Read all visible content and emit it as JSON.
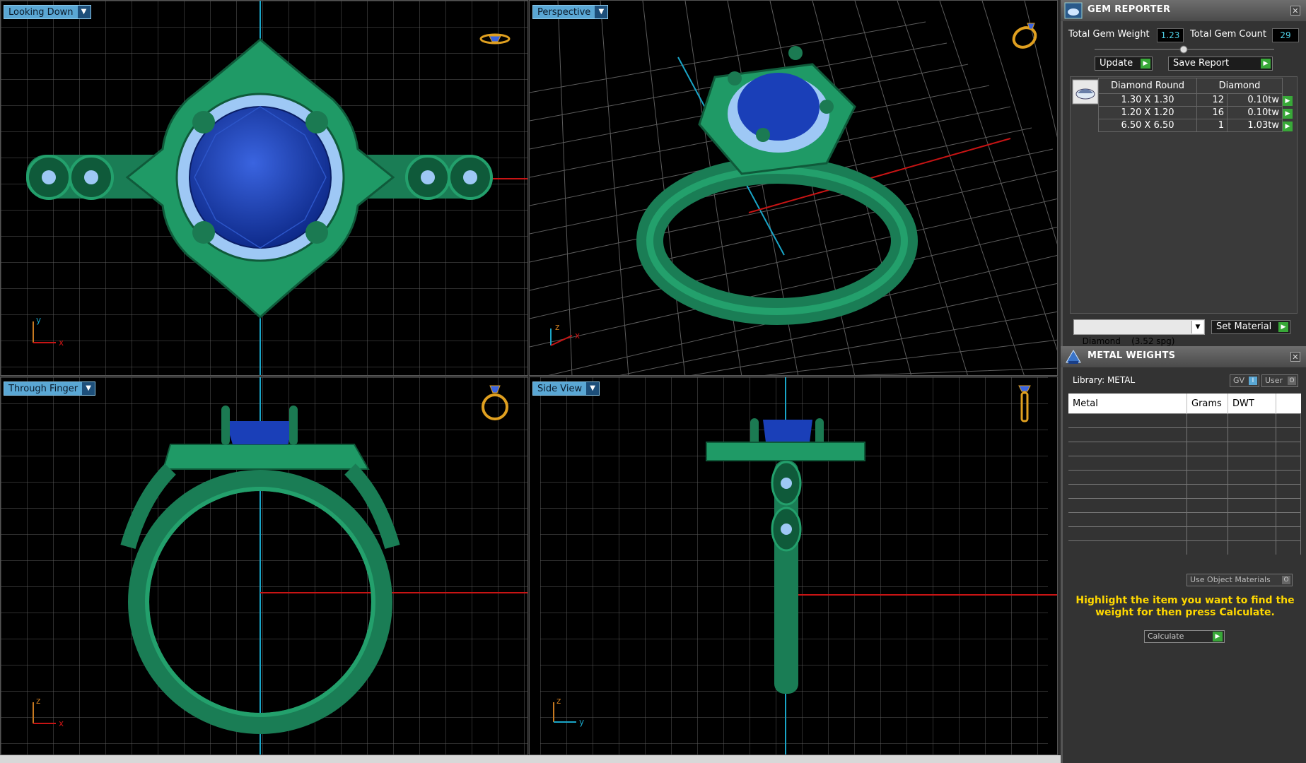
{
  "viewports": {
    "looking_down": {
      "label": "Looking Down",
      "axis1": "y",
      "axis2": "x"
    },
    "perspective": {
      "label": "Perspective",
      "axis1": "z",
      "axis2": "x"
    },
    "through_finger": {
      "label": "Through Finger",
      "axis1": "z",
      "axis2": "x"
    },
    "side_view": {
      "label": "Side View",
      "axis1": "z",
      "axis2": "y"
    }
  },
  "gem_reporter": {
    "title": "GEM REPORTER",
    "total_weight_label": "Total Gem Weight",
    "total_weight_value": "1.23",
    "total_count_label": "Total Gem Count",
    "total_count_value": "29",
    "update_label": "Update",
    "save_report_label": "Save Report",
    "columns": [
      "Diamond Round",
      "Diamond"
    ],
    "rows": [
      {
        "size": "1.30 X 1.30",
        "count": "12",
        "weight": "0.10tw"
      },
      {
        "size": "1.20 X 1.20",
        "count": "16",
        "weight": "0.10tw"
      },
      {
        "size": "6.50 X 6.50",
        "count": "1",
        "weight": "1.03tw"
      }
    ],
    "material_select": "Diamond    (3.52 spg)",
    "set_material_label": "Set Material"
  },
  "metal_weights": {
    "title": "METAL WEIGHTS",
    "library_label": "Library: METAL",
    "gv_label": "GV",
    "user_label": "User",
    "columns": [
      "Metal",
      "Grams",
      "DWT"
    ],
    "use_object_materials_label": "Use Object Materials",
    "hint": "Highlight the item you want to find the weight for then press Calculate.",
    "calculate_label": "Calculate"
  },
  "colors": {
    "metal": "#1f8a5e",
    "metal_dark": "#0f5a3a",
    "gem": "#1a3fb8",
    "accent_diamond": "#9ec8f5",
    "grid": "#6a6a6a",
    "x_axis": "#c81414",
    "y_axis": "#1aa6c8"
  }
}
